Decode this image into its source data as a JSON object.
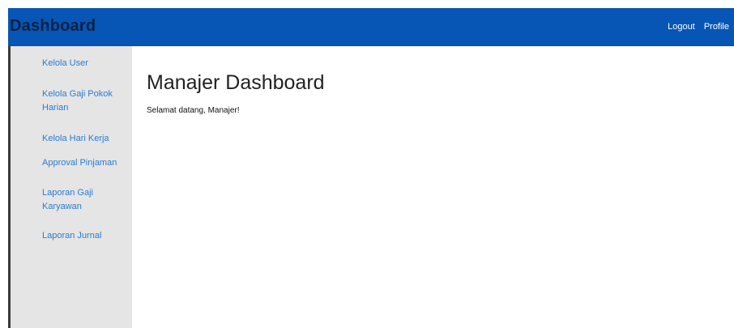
{
  "header": {
    "brand": "Dashboard",
    "nav": {
      "logout": "Logout",
      "profile": "Profile"
    }
  },
  "sidebar": {
    "items": [
      {
        "label": "Kelola User"
      },
      {
        "label": "Kelola Gaji Pokok Harian"
      },
      {
        "label": "Kelola Hari Kerja"
      },
      {
        "label": "Approval Pinjaman"
      },
      {
        "label": "Laporan Gaji Karyawan"
      },
      {
        "label": "Laporan Jurnal"
      }
    ]
  },
  "main": {
    "title": "Manajer Dashboard",
    "welcome": "Selamat datang, Manajer!"
  },
  "colors": {
    "header_bg": "#0755b5",
    "brand_text": "#0b2145",
    "sidebar_bg": "#e5e5e5",
    "link": "#2a7bd0"
  }
}
